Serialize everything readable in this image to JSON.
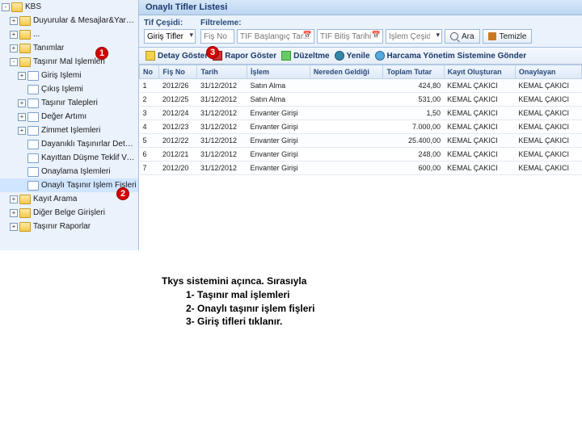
{
  "apptitle": "KBS",
  "sidebar": {
    "items": [
      {
        "label": "KBS",
        "icon": "folder",
        "exp": "-",
        "indent": 0
      },
      {
        "label": "Duyurular & Mesajlar&Yardım",
        "icon": "folder",
        "exp": "+",
        "indent": 1
      },
      {
        "label": "...",
        "icon": "folder",
        "exp": "+",
        "indent": 1
      },
      {
        "label": "Tanımlar",
        "icon": "folder",
        "exp": "+",
        "indent": 1
      },
      {
        "label": "Taşınır Mal İşlemleri",
        "icon": "folder",
        "exp": "-",
        "indent": 1
      },
      {
        "label": "Giriş İşlemi",
        "icon": "page",
        "exp": "+",
        "indent": 2
      },
      {
        "label": "Çıkış İşlemi",
        "icon": "page",
        "exp": "",
        "indent": 2
      },
      {
        "label": "Taşınır Talepleri",
        "icon": "page",
        "exp": "+",
        "indent": 2
      },
      {
        "label": "Değer Artımı",
        "icon": "page",
        "exp": "+",
        "indent": 2
      },
      {
        "label": "Zimmet İşlemleri",
        "icon": "page",
        "exp": "+",
        "indent": 2
      },
      {
        "label": "Dayanıklı Taşınırlar Detay Bilgileri",
        "icon": "page",
        "exp": "",
        "indent": 2
      },
      {
        "label": "Kayıttan Düşme Teklif Ve Onay Tutanağı",
        "icon": "page",
        "exp": "",
        "indent": 2
      },
      {
        "label": "Onaylama İşlemleri",
        "icon": "page",
        "exp": "",
        "indent": 2
      },
      {
        "label": "Onaylı Taşınır İşlem Fişleri",
        "icon": "page",
        "exp": "",
        "indent": 2,
        "selected": true
      },
      {
        "label": "Kayıt Arama",
        "icon": "folder",
        "exp": "+",
        "indent": 1
      },
      {
        "label": "Diğer Belge Girişleri",
        "icon": "folder",
        "exp": "+",
        "indent": 1
      },
      {
        "label": "Taşınır Raporlar",
        "icon": "folder",
        "exp": "+",
        "indent": 1
      }
    ]
  },
  "panel": {
    "title": "Onaylı Tifler Listesi"
  },
  "filter": {
    "tif_label": "Tif Çeşidi:",
    "tif_value": "Giriş Tifleri",
    "filt_label": "Filtreleme:",
    "fisno_ph": "Fiş No",
    "start_ph": "TİF Başlangıç Tarih",
    "end_ph": "TİF Bitiş Tarihi",
    "islem_ph": "İşlem Çeşidi",
    "search": "Ara",
    "clear": "Temizle"
  },
  "toolbar": {
    "detail": "Detay Göster",
    "report": "Rapor Göster",
    "edit": "Düzeltme",
    "refresh": "Yenile",
    "send": "Harcama Yönetim Sistemine Gönder"
  },
  "grid": {
    "headers": [
      "No",
      "Fiş No",
      "Tarih",
      "İşlem",
      "Nereden Geldiği",
      "Toplam Tutar",
      "Kayıt Oluşturan",
      "Onaylayan"
    ],
    "rows": [
      {
        "no": "1",
        "fis": "2012/26",
        "tarih": "31/12/2012",
        "islem": "Satın Alma",
        "nereden": "",
        "tutar": "424,80",
        "kayit": "KEMAL ÇAKICI",
        "onay": "KEMAL ÇAKICI"
      },
      {
        "no": "2",
        "fis": "2012/25",
        "tarih": "31/12/2012",
        "islem": "Satın Alma",
        "nereden": "",
        "tutar": "531,00",
        "kayit": "KEMAL ÇAKICI",
        "onay": "KEMAL ÇAKICI"
      },
      {
        "no": "3",
        "fis": "2012/24",
        "tarih": "31/12/2012",
        "islem": "Envanter Girişi",
        "nereden": "",
        "tutar": "1,50",
        "kayit": "KEMAL ÇAKICI",
        "onay": "KEMAL ÇAKICI"
      },
      {
        "no": "4",
        "fis": "2012/23",
        "tarih": "31/12/2012",
        "islem": "Envanter Girişi",
        "nereden": "",
        "tutar": "7.000,00",
        "kayit": "KEMAL ÇAKICI",
        "onay": "KEMAL ÇAKICI"
      },
      {
        "no": "5",
        "fis": "2012/22",
        "tarih": "31/12/2012",
        "islem": "Envanter Girişi",
        "nereden": "",
        "tutar": "25.400,00",
        "kayit": "KEMAL ÇAKICI",
        "onay": "KEMAL ÇAKICI"
      },
      {
        "no": "6",
        "fis": "2012/21",
        "tarih": "31/12/2012",
        "islem": "Envanter Girişi",
        "nereden": "",
        "tutar": "248,00",
        "kayit": "KEMAL ÇAKICI",
        "onay": "KEMAL ÇAKICI"
      },
      {
        "no": "7",
        "fis": "2012/20",
        "tarih": "31/12/2012",
        "islem": "Envanter Girişi",
        "nereden": "",
        "tutar": "600,00",
        "kayit": "KEMAL ÇAKICI",
        "onay": "KEMAL ÇAKICI"
      }
    ]
  },
  "callouts": {
    "c1": "1",
    "c2": "2",
    "c3": "3"
  },
  "instructions": {
    "line1": "Tkys  sistemini açınca. Sırasıyla",
    "line2": "1- Taşınır mal işlemleri",
    "line3": "2- Onaylı taşınır işlem fişleri",
    "line4": "3- Giriş tifleri   tıklanır."
  }
}
